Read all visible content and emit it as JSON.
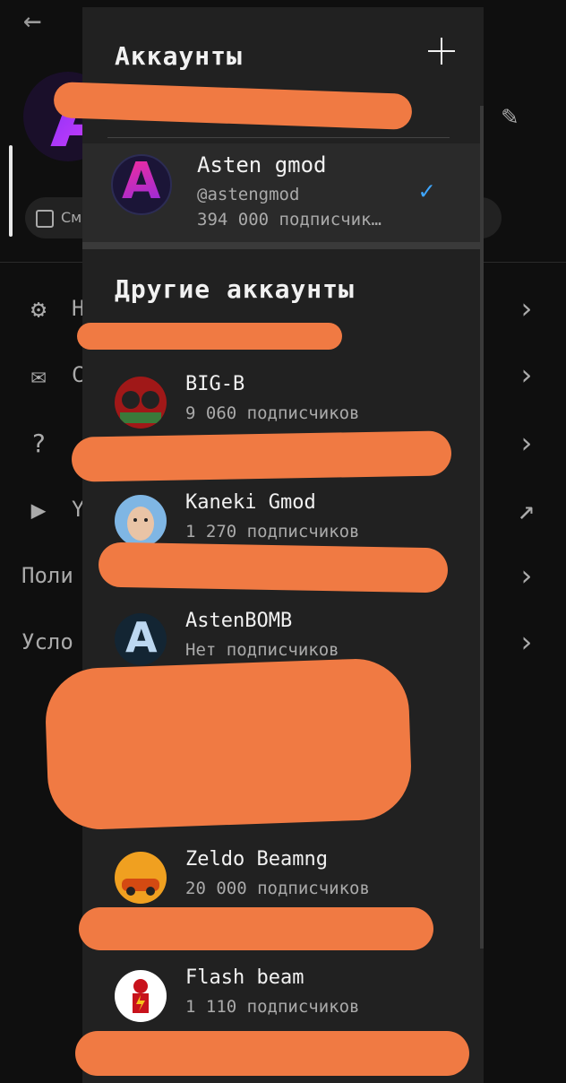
{
  "panel": {
    "title": "Аккаунты",
    "current": {
      "name": "Asten gmod",
      "handle": "@astengmod",
      "subscribers": "394 000 подписчик…",
      "avatar_letter": "A"
    },
    "other_title": "Другие аккаунты",
    "accounts": [
      {
        "name": "BIG-B",
        "subscribers": "9 060 подписчиков"
      },
      {
        "name": "Kaneki Gmod",
        "subscribers": "1 270 подписчиков"
      },
      {
        "name": "AstenBOMB",
        "subscribers": "Нет подписчиков",
        "avatar_letter": "A"
      },
      {
        "name": "Zeldo Beamng",
        "subscribers": "20 000 подписчиков"
      },
      {
        "name": "Flash beam",
        "subscribers": "1 110 подписчиков"
      }
    ]
  },
  "background": {
    "chip_label": "См",
    "row_fragments": [
      "Н",
      "С",
      "",
      "Y"
    ],
    "left_fragments": [
      "Поли",
      "Усло"
    ]
  },
  "colors": {
    "accent": "#3ea6ff",
    "panel": "#212121",
    "scribble": "#f07a43"
  }
}
